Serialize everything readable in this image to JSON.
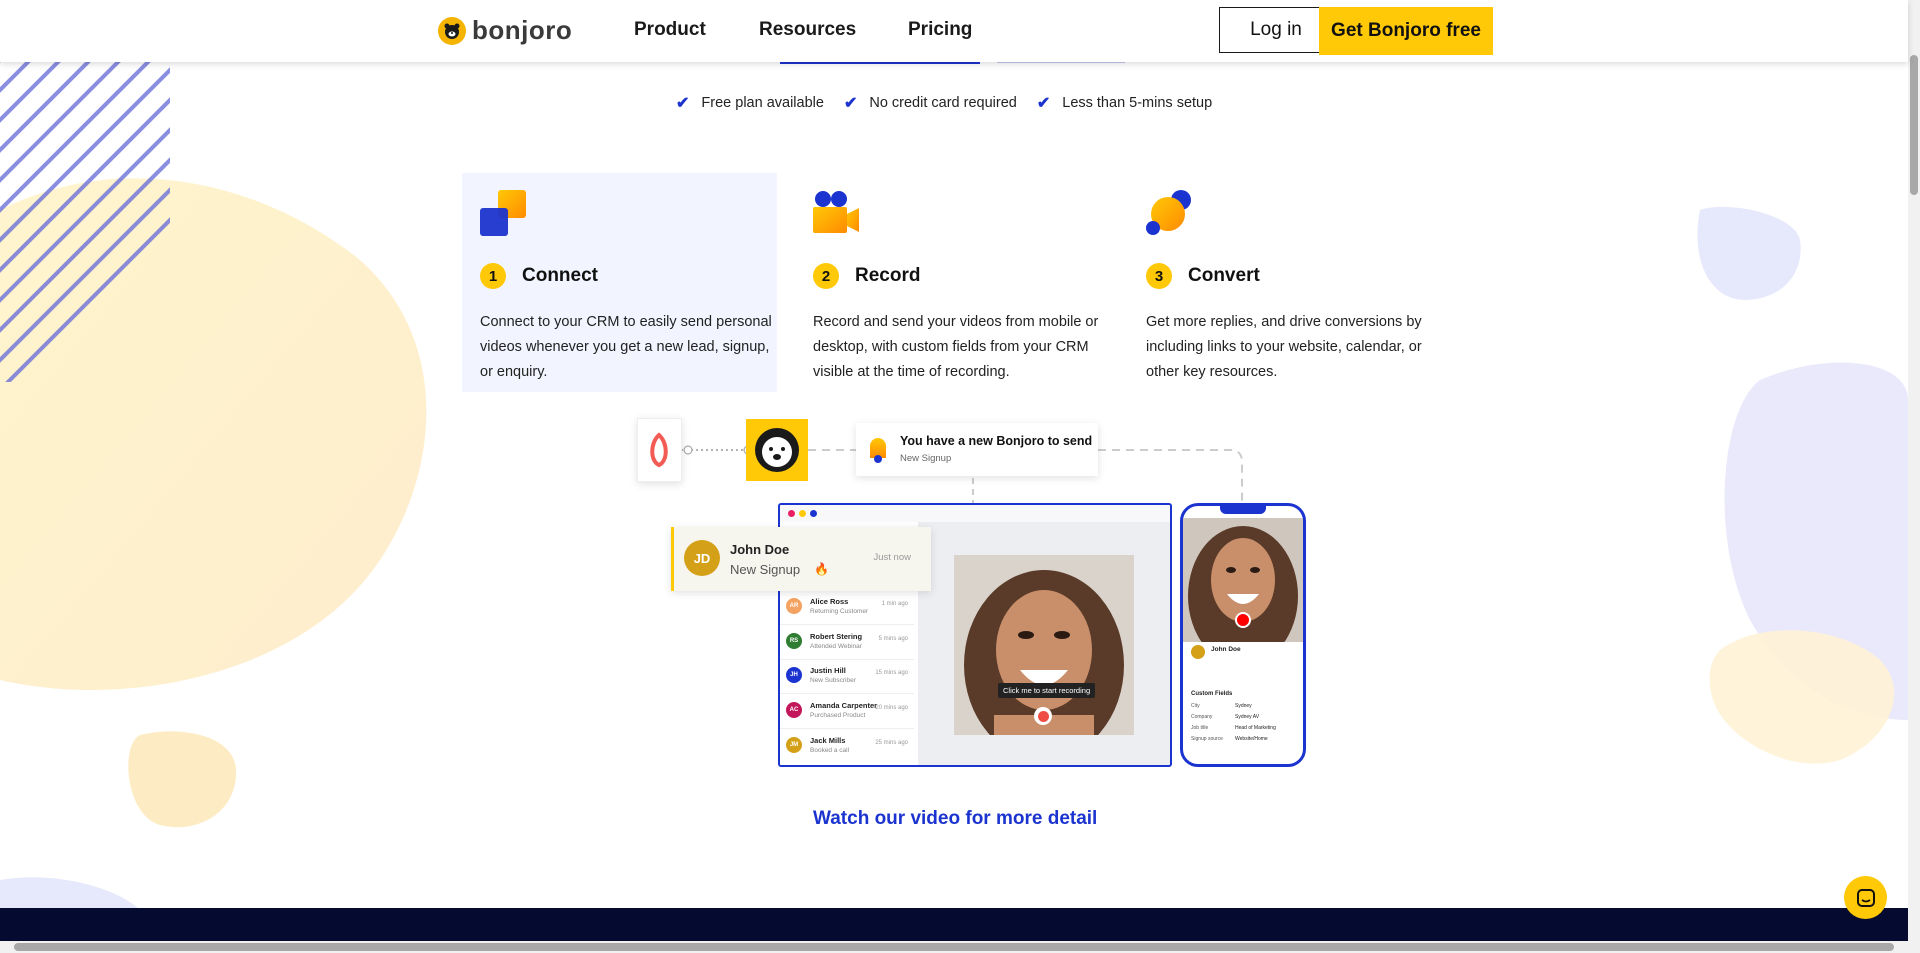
{
  "nav": {
    "logo_text": "bonjoro",
    "links": [
      "Product",
      "Resources",
      "Pricing"
    ],
    "login_label": "Log in",
    "cta_label": "Get Bonjoro free"
  },
  "checks": [
    "Free plan available",
    "No credit card required",
    "Less than 5-mins setup"
  ],
  "steps": [
    {
      "num": "1",
      "title": "Connect",
      "desc": "Connect to your CRM to easily send personal videos whenever you get a new lead, signup, or enquiry."
    },
    {
      "num": "2",
      "title": "Record",
      "desc": "Record and send your videos from mobile or desktop, with custom fields from your CRM visible at the time of recording."
    },
    {
      "num": "3",
      "title": "Convert",
      "desc": "Get more replies, and drive conversions by including links to your website, calendar, or other key resources."
    }
  ],
  "illustration": {
    "notification_title": "You have a new Bonjoro to send",
    "notification_sub": "New Signup",
    "john": {
      "initials": "JD",
      "name": "John Doe",
      "sub": "New Signup",
      "time": "Just now"
    },
    "contacts": [
      {
        "initials": "AR",
        "name": "Alice Ross",
        "sub": "Returning Customer",
        "time": "1 min ago",
        "color": "#f4a261"
      },
      {
        "initials": "RS",
        "name": "Robert Stering",
        "sub": "Attended Webinar",
        "time": "5 mins ago",
        "color": "#2e7d32"
      },
      {
        "initials": "JH",
        "name": "Justin Hill",
        "sub": "New Subscriber",
        "time": "15 mins ago",
        "color": "#1c34cf"
      },
      {
        "initials": "AC",
        "name": "Amanda Carpenter",
        "sub": "Purchased Product",
        "time": "20 mins ago",
        "color": "#c2185b"
      },
      {
        "initials": "JM",
        "name": "Jack Mills",
        "sub": "Booked a call",
        "time": "25 mins ago",
        "color": "#d4a017"
      }
    ],
    "record_hint": "Click me to start recording",
    "phone": {
      "name": "John Doe",
      "custom_fields_title": "Custom Fields",
      "fields": [
        {
          "label": "City",
          "value": "Sydney"
        },
        {
          "label": "Company",
          "value": "Sydney AV"
        },
        {
          "label": "Job title",
          "value": "Head of Marketing"
        },
        {
          "label": "Signup source",
          "value": "Website/Home"
        }
      ]
    }
  },
  "watch_label": "Watch our video for more detail",
  "colors": {
    "accent": "#1c34cf",
    "brand_yellow": "#ffc907",
    "footer": "#050a30"
  }
}
